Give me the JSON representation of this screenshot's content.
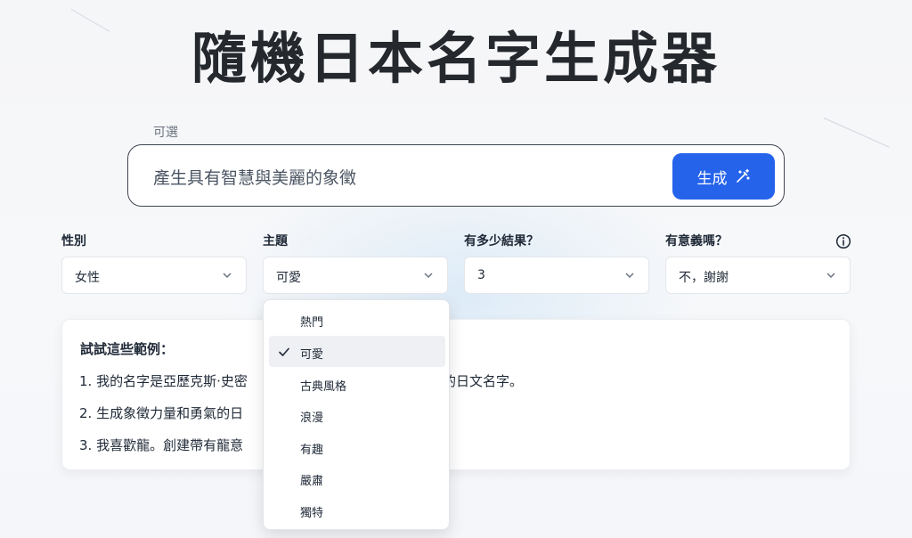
{
  "title": "隨機日本名字生成器",
  "prompt": {
    "optional_label": "可選",
    "value": "產生具有智慧與美麗的象徵",
    "generate_label": "生成"
  },
  "fields": [
    {
      "label": "性別",
      "value": "女性"
    },
    {
      "label": "主題",
      "value": "可愛"
    },
    {
      "label": "有多少結果？",
      "value": "3"
    },
    {
      "label": "有意義嗎？",
      "value": "不，謝謝"
    }
  ],
  "examples": {
    "title": "試試這些範例：",
    "items": [
      {
        "left": "1. 我的名字是亞歷克斯·史密",
        "right": "近的日文名字。"
      },
      {
        "left": "2. 生成象徵力量和勇氣的日"
      },
      {
        "left": "3. 我喜歡龍。創建帶有龍意"
      }
    ]
  },
  "theme_dropdown": {
    "options": [
      "熱門",
      "可愛",
      "古典風格",
      "浪漫",
      "有趣",
      "嚴肅",
      "獨特"
    ],
    "selected": "可愛"
  },
  "colors": {
    "accent": "#2563eb",
    "title": "#25282d"
  },
  "icons": {
    "generate": "magic-wand-icon",
    "select": "chevron-down-icon",
    "info": "info-icon",
    "selected_option": "check-icon"
  }
}
